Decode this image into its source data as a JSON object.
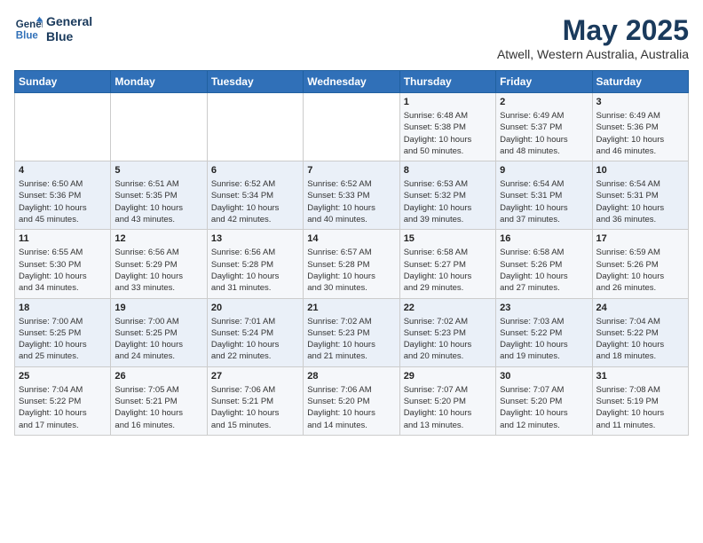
{
  "header": {
    "logo_line1": "General",
    "logo_line2": "Blue",
    "title": "May 2025",
    "subtitle": "Atwell, Western Australia, Australia"
  },
  "weekdays": [
    "Sunday",
    "Monday",
    "Tuesday",
    "Wednesday",
    "Thursday",
    "Friday",
    "Saturday"
  ],
  "weeks": [
    [
      {
        "day": "",
        "info": ""
      },
      {
        "day": "",
        "info": ""
      },
      {
        "day": "",
        "info": ""
      },
      {
        "day": "",
        "info": ""
      },
      {
        "day": "1",
        "info": "Sunrise: 6:48 AM\nSunset: 5:38 PM\nDaylight: 10 hours\nand 50 minutes."
      },
      {
        "day": "2",
        "info": "Sunrise: 6:49 AM\nSunset: 5:37 PM\nDaylight: 10 hours\nand 48 minutes."
      },
      {
        "day": "3",
        "info": "Sunrise: 6:49 AM\nSunset: 5:36 PM\nDaylight: 10 hours\nand 46 minutes."
      }
    ],
    [
      {
        "day": "4",
        "info": "Sunrise: 6:50 AM\nSunset: 5:36 PM\nDaylight: 10 hours\nand 45 minutes."
      },
      {
        "day": "5",
        "info": "Sunrise: 6:51 AM\nSunset: 5:35 PM\nDaylight: 10 hours\nand 43 minutes."
      },
      {
        "day": "6",
        "info": "Sunrise: 6:52 AM\nSunset: 5:34 PM\nDaylight: 10 hours\nand 42 minutes."
      },
      {
        "day": "7",
        "info": "Sunrise: 6:52 AM\nSunset: 5:33 PM\nDaylight: 10 hours\nand 40 minutes."
      },
      {
        "day": "8",
        "info": "Sunrise: 6:53 AM\nSunset: 5:32 PM\nDaylight: 10 hours\nand 39 minutes."
      },
      {
        "day": "9",
        "info": "Sunrise: 6:54 AM\nSunset: 5:31 PM\nDaylight: 10 hours\nand 37 minutes."
      },
      {
        "day": "10",
        "info": "Sunrise: 6:54 AM\nSunset: 5:31 PM\nDaylight: 10 hours\nand 36 minutes."
      }
    ],
    [
      {
        "day": "11",
        "info": "Sunrise: 6:55 AM\nSunset: 5:30 PM\nDaylight: 10 hours\nand 34 minutes."
      },
      {
        "day": "12",
        "info": "Sunrise: 6:56 AM\nSunset: 5:29 PM\nDaylight: 10 hours\nand 33 minutes."
      },
      {
        "day": "13",
        "info": "Sunrise: 6:56 AM\nSunset: 5:28 PM\nDaylight: 10 hours\nand 31 minutes."
      },
      {
        "day": "14",
        "info": "Sunrise: 6:57 AM\nSunset: 5:28 PM\nDaylight: 10 hours\nand 30 minutes."
      },
      {
        "day": "15",
        "info": "Sunrise: 6:58 AM\nSunset: 5:27 PM\nDaylight: 10 hours\nand 29 minutes."
      },
      {
        "day": "16",
        "info": "Sunrise: 6:58 AM\nSunset: 5:26 PM\nDaylight: 10 hours\nand 27 minutes."
      },
      {
        "day": "17",
        "info": "Sunrise: 6:59 AM\nSunset: 5:26 PM\nDaylight: 10 hours\nand 26 minutes."
      }
    ],
    [
      {
        "day": "18",
        "info": "Sunrise: 7:00 AM\nSunset: 5:25 PM\nDaylight: 10 hours\nand 25 minutes."
      },
      {
        "day": "19",
        "info": "Sunrise: 7:00 AM\nSunset: 5:25 PM\nDaylight: 10 hours\nand 24 minutes."
      },
      {
        "day": "20",
        "info": "Sunrise: 7:01 AM\nSunset: 5:24 PM\nDaylight: 10 hours\nand 22 minutes."
      },
      {
        "day": "21",
        "info": "Sunrise: 7:02 AM\nSunset: 5:23 PM\nDaylight: 10 hours\nand 21 minutes."
      },
      {
        "day": "22",
        "info": "Sunrise: 7:02 AM\nSunset: 5:23 PM\nDaylight: 10 hours\nand 20 minutes."
      },
      {
        "day": "23",
        "info": "Sunrise: 7:03 AM\nSunset: 5:22 PM\nDaylight: 10 hours\nand 19 minutes."
      },
      {
        "day": "24",
        "info": "Sunrise: 7:04 AM\nSunset: 5:22 PM\nDaylight: 10 hours\nand 18 minutes."
      }
    ],
    [
      {
        "day": "25",
        "info": "Sunrise: 7:04 AM\nSunset: 5:22 PM\nDaylight: 10 hours\nand 17 minutes."
      },
      {
        "day": "26",
        "info": "Sunrise: 7:05 AM\nSunset: 5:21 PM\nDaylight: 10 hours\nand 16 minutes."
      },
      {
        "day": "27",
        "info": "Sunrise: 7:06 AM\nSunset: 5:21 PM\nDaylight: 10 hours\nand 15 minutes."
      },
      {
        "day": "28",
        "info": "Sunrise: 7:06 AM\nSunset: 5:20 PM\nDaylight: 10 hours\nand 14 minutes."
      },
      {
        "day": "29",
        "info": "Sunrise: 7:07 AM\nSunset: 5:20 PM\nDaylight: 10 hours\nand 13 minutes."
      },
      {
        "day": "30",
        "info": "Sunrise: 7:07 AM\nSunset: 5:20 PM\nDaylight: 10 hours\nand 12 minutes."
      },
      {
        "day": "31",
        "info": "Sunrise: 7:08 AM\nSunset: 5:19 PM\nDaylight: 10 hours\nand 11 minutes."
      }
    ]
  ]
}
